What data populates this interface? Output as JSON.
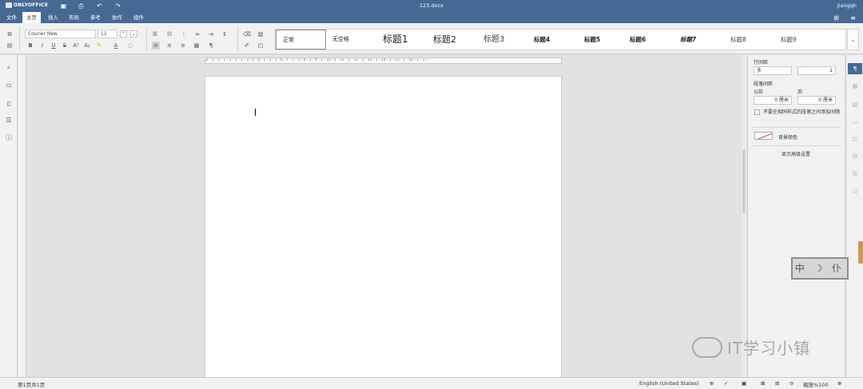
{
  "app": {
    "logo": "ONLYOFFICE",
    "doc_title": "123.docx",
    "user": "jiangqh"
  },
  "menu_tabs": [
    "文件",
    "主页",
    "插入",
    "布局",
    "参考",
    "协作",
    "组件"
  ],
  "toolbar": {
    "font_name": "Courier New",
    "font_size": "11",
    "styles": [
      "正常",
      "无空格",
      "标题1",
      "标题2",
      "标题3",
      "标题4",
      "标题5",
      "标题6",
      "标题7",
      "标题8",
      "标题9"
    ]
  },
  "ruler": {
    "labels": "1 · 2 · 1 · 1 · 1 · 2 · 1 · 3 · 1 · 4 · 1 · 5 · 1 · 6 · 1 · 7 · 1 · 8 · 1 · 9 · 1 · 10 · 1 · 11 · 1 · 12 · 1 · 13 · 1 · 14 · 1 · 15 · 1 · 16 · 1 · 17 ·"
  },
  "paragraph_settings": {
    "line_spacing_label": "行间距",
    "line_spacing_type": "多",
    "line_spacing_value": "1",
    "para_spacing_label": "段落间距",
    "before_label": "以前",
    "after_label": "后",
    "before_value": "0 厘米",
    "after_value": "0 厘米",
    "dont_add_interval": "不要在相同样式的段落之间添加间隔",
    "background_color": "背景颜色",
    "show_advanced": "显示高级设置"
  },
  "status": {
    "page_info": "第1页共1页",
    "language": "English (United States)",
    "zoom": "缩放%100"
  },
  "overlay": {
    "watermark": "IT学习小镇",
    "stamp": "中 ☽ 仆"
  }
}
